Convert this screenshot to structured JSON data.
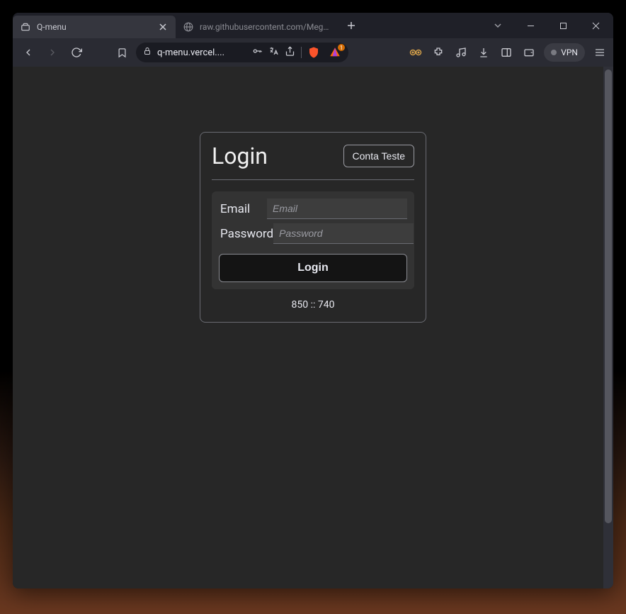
{
  "browser": {
    "tabs": [
      {
        "title": "Q-menu",
        "active": true
      },
      {
        "title": "raw.githubusercontent.com/Megas-M",
        "active": false
      }
    ],
    "url_display": "q-menu.vercel....",
    "vpn_label": "VPN",
    "brave_badge": "1"
  },
  "login": {
    "title": "Login",
    "conta_teste_label": "Conta Teste",
    "email_label": "Email",
    "email_placeholder": "Email",
    "password_label": "Password",
    "password_placeholder": "Password",
    "submit_label": "Login",
    "dimensions_text": "850 :: 740"
  }
}
